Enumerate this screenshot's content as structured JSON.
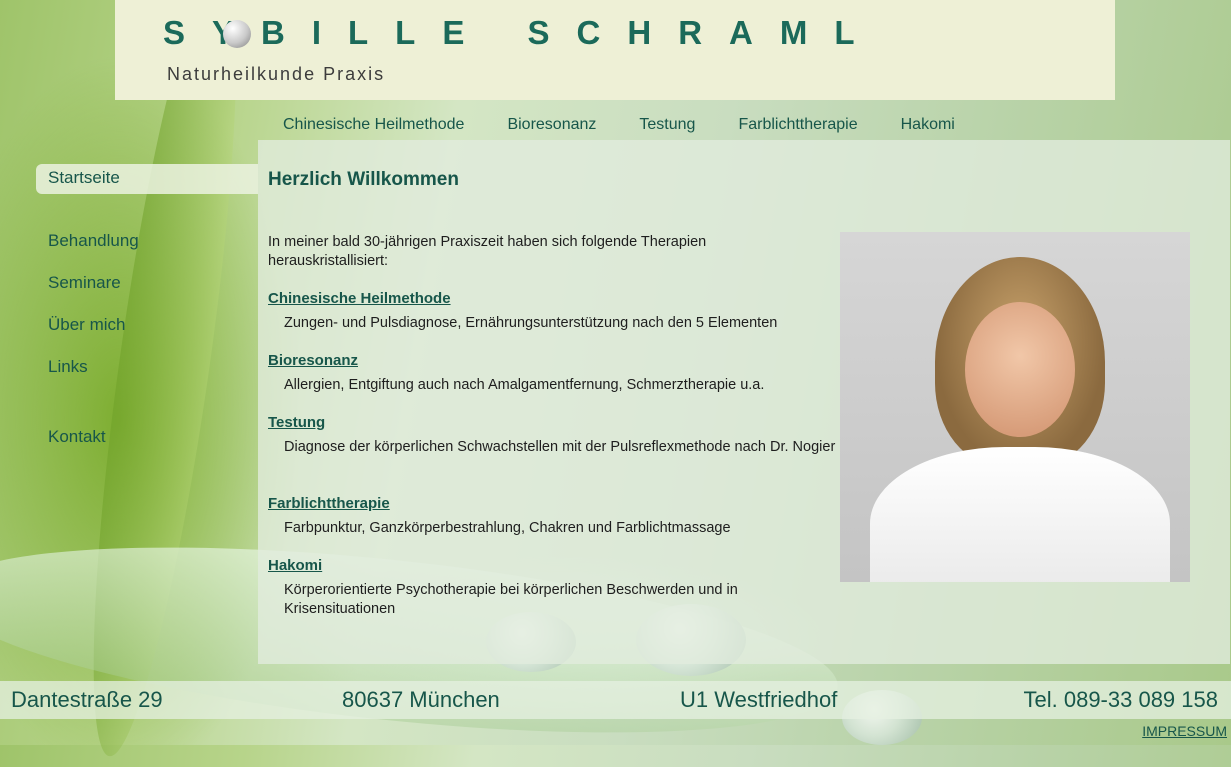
{
  "header": {
    "name": "SYBILLE SCHRAML",
    "subtitle": "Naturheilkunde Praxis"
  },
  "topnav": [
    "Chinesische Heilmethode",
    "Bioresonanz",
    "Testung",
    "Farblichttherapie",
    "Hakomi"
  ],
  "sidenav": {
    "active": "Startseite",
    "group1": [
      "Behandlung",
      "Seminare",
      "Über mich",
      "Links"
    ],
    "contact": "Kontakt"
  },
  "main": {
    "title": "Herzlich Willkommen",
    "intro": "In meiner bald 30-jährigen Praxiszeit haben sich folgende Therapien herauskristallisiert:",
    "services": [
      {
        "title": "Chinesische Heilmethode",
        "desc": "Zungen- und Pulsdiagnose, Ernährungsunterstützung nach den 5 Elementen"
      },
      {
        "title": "Bioresonanz",
        "desc": "Allergien, Entgiftung auch nach Amalgamentfernung, Schmerztherapie u.a."
      },
      {
        "title": "Testung",
        "desc": "Diagnose der körperlichen Schwachstellen mit der Pulsreflexmethode nach Dr. Nogier"
      },
      {
        "title": "Farblichttherapie",
        "desc": "Farbpunktur, Ganzkörperbestrahlung, Chakren und Farblichtmassage"
      },
      {
        "title": "Hakomi",
        "desc": "Körperorientierte Psychotherapie bei körperlichen Beschwerden und in Krisensituationen"
      }
    ]
  },
  "footer": {
    "street": "Dantestraße 29",
    "city": "80637 München",
    "transit": "U1 Westfriedhof",
    "phone": "Tel. 089-33 089 158",
    "impressum": "IMPRESSUM"
  },
  "colors": {
    "accent": "#17564a",
    "header_bg": "#eef0d6"
  }
}
